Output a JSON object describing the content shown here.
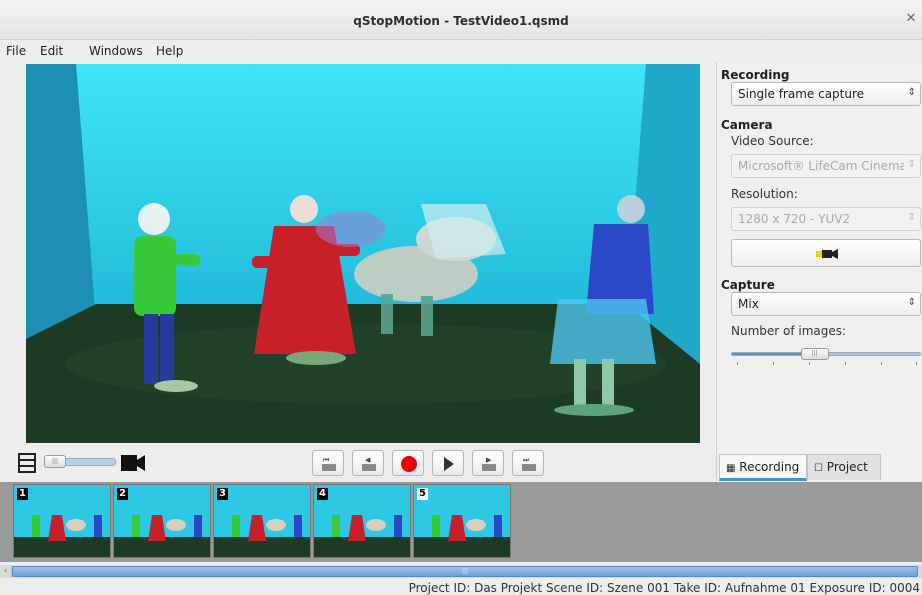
{
  "window": {
    "title": "qStopMotion - TestVideo1.qsmd"
  },
  "menu": [
    {
      "label": "File"
    },
    {
      "label": "Edit"
    },
    {
      "label": "Windows"
    },
    {
      "label": "Help"
    }
  ],
  "recording_panel": {
    "recording_heading": "Recording",
    "recording_mode": "Single frame capture",
    "camera_heading": "Camera",
    "video_source_label": "Video Source:",
    "video_source_value": "Microsoft® LifeCam Cinema(TM",
    "resolution_label": "Resolution:",
    "resolution_value": "1280 x 720 - YUV2",
    "capture_heading": "Capture",
    "capture_mode": "Mix",
    "number_images_label": "Number of images:",
    "number_images_level": 0.44
  },
  "panel_tabs": [
    {
      "label": "Recording",
      "active": true
    },
    {
      "label": "Project",
      "active": false
    }
  ],
  "frames": [
    {
      "number": "1"
    },
    {
      "number": "2"
    },
    {
      "number": "3"
    },
    {
      "number": "4"
    },
    {
      "number": "5"
    }
  ],
  "status": {
    "text": "Project ID:  Das Projekt  Scene ID:  Szene 001  Take ID:  Aufnahme 01  Exposure ID:  0004"
  },
  "colors": {
    "record": "#e00000",
    "accent": "#4a90d9",
    "wall": "#2fd0ea",
    "floor": "#1d3b24"
  }
}
